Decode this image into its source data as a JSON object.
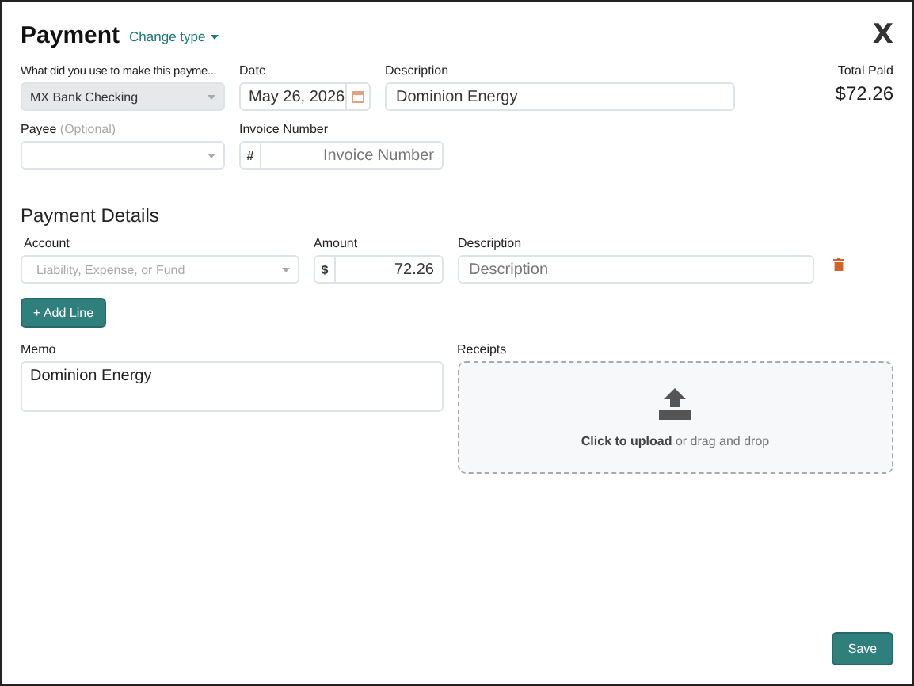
{
  "header": {
    "title": "Payment",
    "change_type": "Change type",
    "close": "X"
  },
  "source": {
    "label": "What did you use to make this payme...",
    "value": "MX Bank Checking",
    "disabled": true
  },
  "date": {
    "label": "Date",
    "value": "May 26, 2026"
  },
  "description": {
    "label": "Description",
    "value": "Dominion Energy"
  },
  "total": {
    "label": "Total Paid",
    "value": "$72.26"
  },
  "payee": {
    "label": "Payee",
    "hint": "(Optional)"
  },
  "invoice": {
    "label": "Invoice Number",
    "prefix": "#",
    "placeholder": "Invoice Number"
  },
  "details": {
    "title": "Payment Details",
    "columns": [
      "Account",
      "Amount",
      "Description"
    ],
    "lines": [
      {
        "account_placeholder": "Liability, Expense, or Fund",
        "currency": "$",
        "amount": "72.26",
        "description_placeholder": "Description"
      }
    ],
    "add_line": "+ Add Line"
  },
  "memo": {
    "label": "Memo",
    "value": "Dominion Energy"
  },
  "receipts": {
    "label": "Receipts",
    "upload_text": "**Click to upload** or drag and drop"
  },
  "save": "Save"
}
